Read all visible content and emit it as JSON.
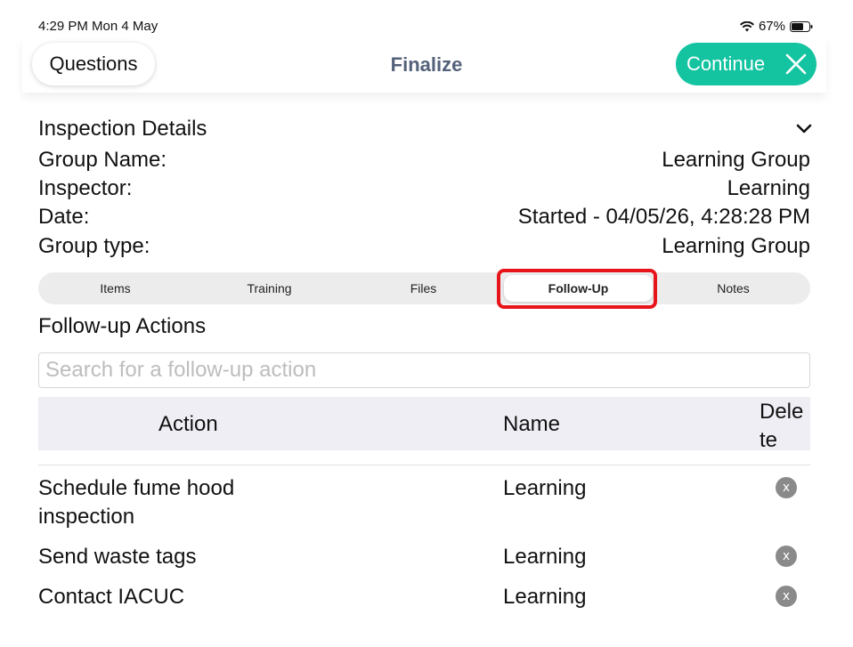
{
  "status_bar": {
    "time": "4:29 PM  Mon 4 May",
    "battery": "67%"
  },
  "nav": {
    "back_label": "Questions",
    "title": "Finalize",
    "continue_label": "Continue"
  },
  "details": {
    "title": "Inspection Details",
    "rows": [
      {
        "label": "Group Name:",
        "value": "Learning Group"
      },
      {
        "label": "Inspector:",
        "value": "Learning"
      },
      {
        "label": "Date:",
        "value": "Started - 04/05/26, 4:28:28 PM"
      },
      {
        "label": "Group type:",
        "value": "Learning Group"
      }
    ]
  },
  "tabs": [
    {
      "label": "Items"
    },
    {
      "label": "Training"
    },
    {
      "label": "Files"
    },
    {
      "label": "Follow-Up",
      "active": true
    },
    {
      "label": "Notes"
    }
  ],
  "followup": {
    "title": "Follow-up Actions",
    "search_placeholder": "Search for a follow-up action",
    "columns": {
      "action": "Action",
      "name": "Name",
      "delete": "Dele te"
    },
    "rows": [
      {
        "action": "Schedule fume hood inspection",
        "name": "Learning"
      },
      {
        "action": "Send waste tags",
        "name": "Learning"
      },
      {
        "action": "Contact IACUC",
        "name": "Learning"
      }
    ]
  },
  "colors": {
    "accent": "#14c3a0",
    "title": "#54617a",
    "highlight": "#e8141c",
    "header_bg": "#eeeef4"
  },
  "icons": {
    "wifi": "wifi-icon",
    "battery": "battery-icon",
    "close": "close-icon",
    "chevron": "chevron-down-icon",
    "delete": "delete-x-icon"
  }
}
